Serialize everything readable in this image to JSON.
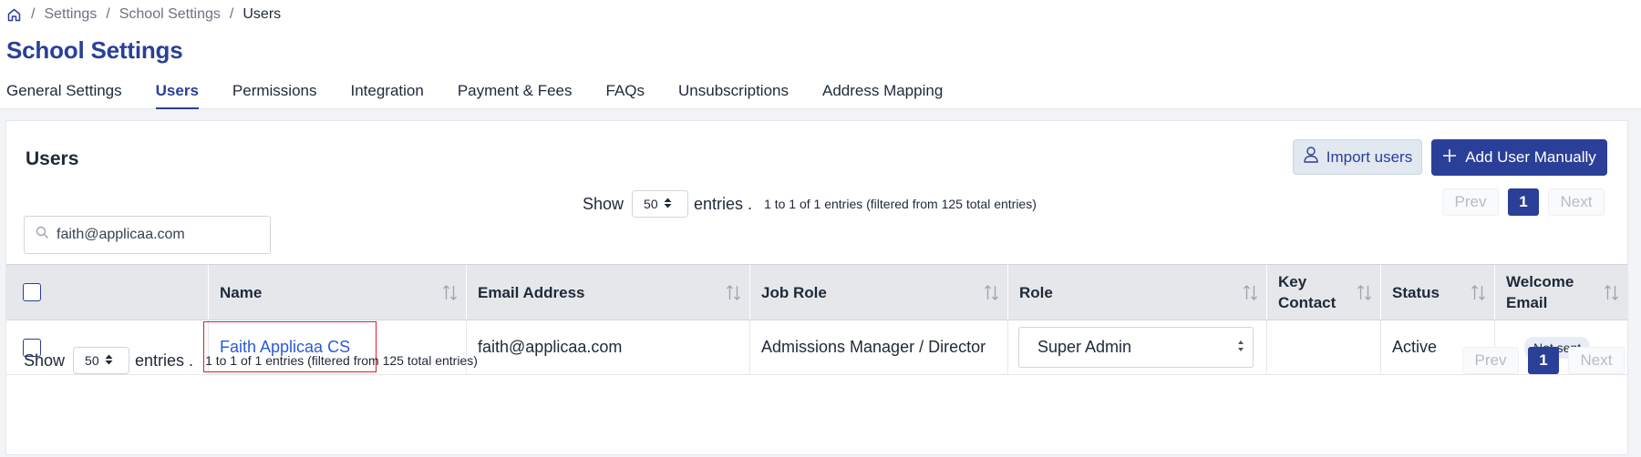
{
  "breadcrumb": {
    "home_icon": "home-icon",
    "items": [
      "Settings",
      "School Settings"
    ],
    "current": "Users"
  },
  "page_title": "School Settings",
  "tabs": [
    {
      "label": "General Settings"
    },
    {
      "label": "Users"
    },
    {
      "label": "Permissions"
    },
    {
      "label": "Integration"
    },
    {
      "label": "Payment & Fees"
    },
    {
      "label": "FAQs"
    },
    {
      "label": "Unsubscriptions"
    },
    {
      "label": "Address Mapping"
    }
  ],
  "active_tab": "Users",
  "card": {
    "title": "Users",
    "import_label": "Import users",
    "add_label": "Add User Manually"
  },
  "search": {
    "value": "faith@applicaa.com",
    "icon": "search-icon"
  },
  "show": {
    "prefix": "Show",
    "value": "50",
    "suffix": "entries ."
  },
  "entries_info": "1 to 1 of 1 entries (filtered from 125 total entries)",
  "pagination": {
    "prev": "Prev",
    "page": "1",
    "next": "Next"
  },
  "table": {
    "columns": [
      "Name",
      "Email Address",
      "Job Role",
      "Role",
      "Key Contact",
      "Status",
      "Welcome Email"
    ],
    "rows": [
      {
        "name": "Faith Applicaa CS",
        "email": "faith@applicaa.com",
        "job_role": "Admissions Manager / Director",
        "role": "Super Admin",
        "key_contact": "",
        "status": "Active",
        "welcome_email": "Not sent"
      }
    ]
  },
  "colors": {
    "primary": "#2a3f97",
    "link": "#2a5bd7",
    "highlight": "#e11d24",
    "header_bg": "#e5e7eb"
  }
}
